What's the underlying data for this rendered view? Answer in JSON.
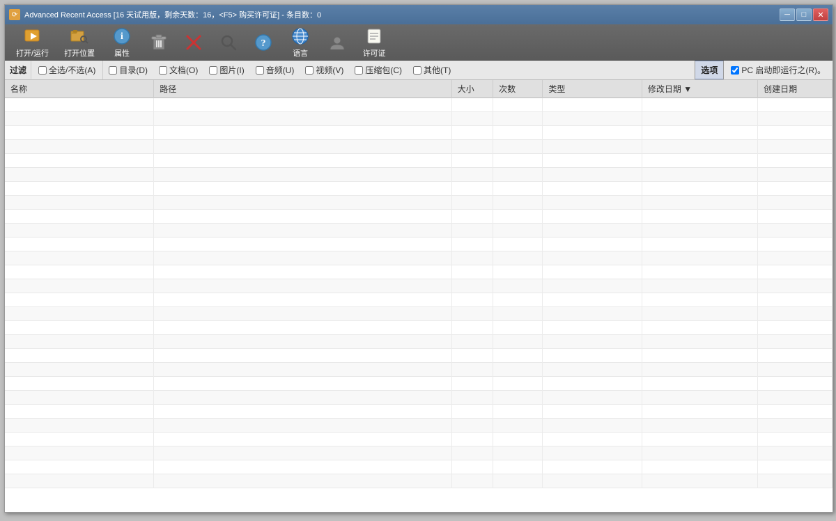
{
  "window": {
    "title": "Advanced Recent Access [16 天试用版，剩余天数：16，<F5> 购买许可证] - 条目数：0",
    "icon_char": "⟳"
  },
  "titlebar_controls": {
    "minimize": "─",
    "maximize": "□",
    "close": "✕"
  },
  "toolbar": {
    "buttons": [
      {
        "id": "open-run",
        "label": "打开/运行",
        "icon": "▶"
      },
      {
        "id": "open-location",
        "label": "打开位置",
        "icon": "📁"
      },
      {
        "id": "properties",
        "label": "属性",
        "icon": "ℹ"
      },
      {
        "id": "delete",
        "label": "",
        "icon": "🗑"
      },
      {
        "id": "close-item",
        "label": "",
        "icon": "✕"
      },
      {
        "id": "search",
        "label": "",
        "icon": "🔍"
      },
      {
        "id": "help",
        "label": "",
        "icon": "❓"
      },
      {
        "id": "language",
        "label": "语言",
        "icon": "🌐"
      },
      {
        "id": "user",
        "label": "",
        "icon": "👤"
      },
      {
        "id": "license",
        "label": "许可证",
        "icon": ""
      }
    ]
  },
  "filter_bar": {
    "filter_label": "过滤",
    "all_select": "全选/不选(A)",
    "items": [
      {
        "id": "directory",
        "label": "目录(D)"
      },
      {
        "id": "document",
        "label": "文档(O)"
      },
      {
        "id": "image",
        "label": "图片(I)"
      },
      {
        "id": "audio",
        "label": "音频(U)"
      },
      {
        "id": "video",
        "label": "视频(V)"
      },
      {
        "id": "archive",
        "label": "压缩包(C)"
      },
      {
        "id": "other",
        "label": "其他(T)"
      }
    ],
    "selected_tab": "选项",
    "options_checkbox": "PC 启动即运行之(R)。"
  },
  "table": {
    "columns": [
      {
        "id": "name",
        "label": "名称",
        "width": "18%"
      },
      {
        "id": "path",
        "label": "路径",
        "width": "36%"
      },
      {
        "id": "size",
        "label": "大小",
        "width": "5%"
      },
      {
        "id": "count",
        "label": "次数",
        "width": "6%"
      },
      {
        "id": "type",
        "label": "类型",
        "width": "12%"
      },
      {
        "id": "modified",
        "label": "修改日期 ▼",
        "width": "14%"
      },
      {
        "id": "created",
        "label": "创建日期",
        "width": "9%"
      }
    ],
    "rows": []
  }
}
